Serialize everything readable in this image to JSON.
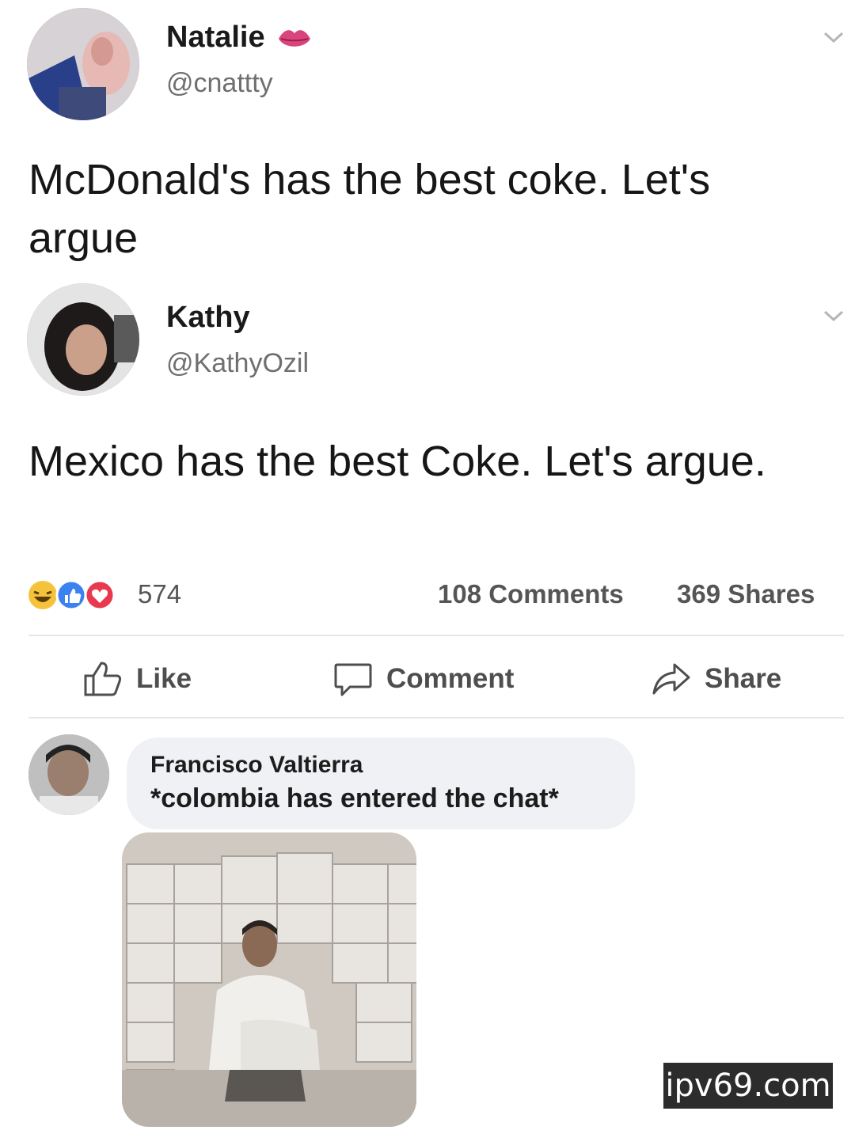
{
  "posts": [
    {
      "name": "Natalie",
      "handle": "@cnattty",
      "text": "McDonald's has the best coke. Let's argue",
      "badge": "lips-emoji"
    },
    {
      "name": "Kathy",
      "handle": "@KathyOzil",
      "text": "Mexico has the best Coke. Let's argue."
    }
  ],
  "stats": {
    "reactions_count": "574",
    "comments_count": "108 Comments",
    "shares_count": "369 Shares"
  },
  "actions": {
    "like_label": "Like",
    "comment_label": "Comment",
    "share_label": "Share"
  },
  "comment": {
    "author": "Francisco Valtierra",
    "text": "*colombia has entered the chat*"
  },
  "watermark": "ipv69.com",
  "colors": {
    "like_blue": "#3b82f0",
    "love_red": "#e8394f",
    "haha_yellow": "#f5c33b",
    "text_gray": "#555555"
  }
}
